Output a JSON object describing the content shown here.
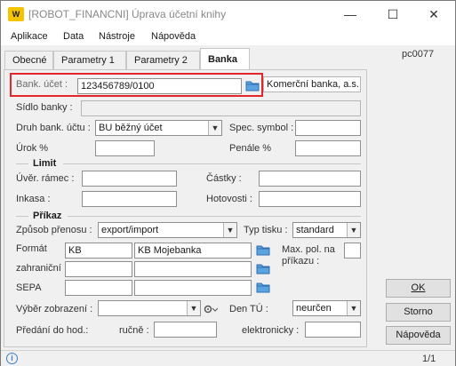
{
  "window": {
    "title": "[ROBOT_FINANCNI] Úprava účetní knihy",
    "logo_text": "W",
    "minimize": "—",
    "maximize": "☐",
    "close": "✕"
  },
  "menu": [
    "Aplikace",
    "Data",
    "Nástroje",
    "Nápověda"
  ],
  "tabs": [
    "Obecné",
    "Parametry 1",
    "Parametry 2",
    "Banka"
  ],
  "user_id": "pc0077",
  "form": {
    "bank_account_label": "Bank. účet :",
    "bank_account_value": "123456789/0100",
    "bank_name_value": "Komerční banka, a.s.",
    "bank_seat_label": "Sídlo banky :",
    "bank_seat_value": "",
    "account_type_label": "Druh bank. účtu :",
    "account_type_value": "BU běžný účet",
    "spec_symbol_label": "Spec. symbol :",
    "interest_label": "Úrok %",
    "penalty_label": "Penále %",
    "limit_section": "Limit",
    "credit_frame_label": "Úvěr. rámec :",
    "amounts_label": "Částky :",
    "inkasa_label": "Inkasa :",
    "cash_label": "Hotovosti :",
    "order_section": "Příkaz",
    "transfer_method_label": "Způsob přenosu :",
    "transfer_method_value": "export/import",
    "print_type_label": "Typ tisku :",
    "print_type_value": "standard",
    "format_label": "Formát",
    "format_code": "KB",
    "format_name": "KB Mojebanka",
    "max_items_label_1": "Max. pol. na",
    "max_items_label_2": "příkazu :",
    "foreign_label": "zahraniční",
    "sepa_label": "SEPA",
    "display_choice_label": "Výběr zobrazení :",
    "den_tu_label": "Den TÚ :",
    "den_tu_value": "neurčen",
    "handover_label": "Předání do hod.:",
    "manual_label": "ručně :",
    "electronic_label": "elektronicky :"
  },
  "buttons": {
    "ok": "OK",
    "cancel": "Storno",
    "help": "Nápověda"
  },
  "status": {
    "info_icon": "i",
    "page": "1/1"
  },
  "colors": {
    "highlight": "#e3262c",
    "folder": "#3c8dd6",
    "logo": "#f5c400"
  }
}
